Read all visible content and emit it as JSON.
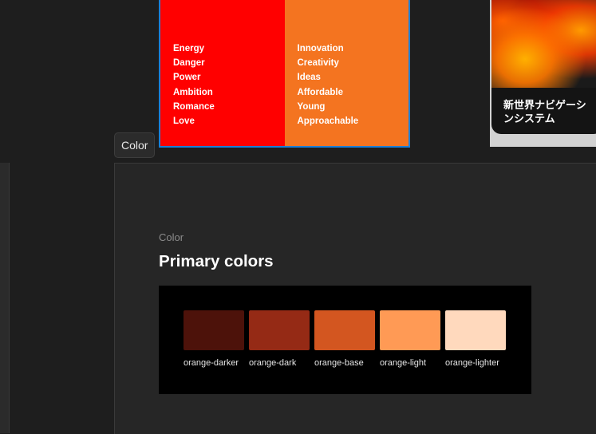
{
  "meaning_card": {
    "red": {
      "color": "#ff0000",
      "words": [
        "Energy",
        "Danger",
        "Power",
        "Ambition",
        "Romance",
        "Love"
      ]
    },
    "orange": {
      "color": "#f47420",
      "words": [
        "Innovation",
        "Creativity",
        "Ideas",
        "Affordable",
        "Young",
        "Approachable"
      ]
    }
  },
  "preview_tile": {
    "title": "新世界ナビゲーシ\nンシステム"
  },
  "frame_tag": "Color",
  "section": {
    "label": "Color",
    "title": "Primary colors"
  },
  "swatches": [
    {
      "name": "orange-darker",
      "color": "#4d120a"
    },
    {
      "name": "orange-dark",
      "color": "#952a15"
    },
    {
      "name": "orange-base",
      "color": "#d35620"
    },
    {
      "name": "orange-light",
      "color": "#ff9a55"
    },
    {
      "name": "orange-lighter",
      "color": "#ffd9bd"
    }
  ]
}
